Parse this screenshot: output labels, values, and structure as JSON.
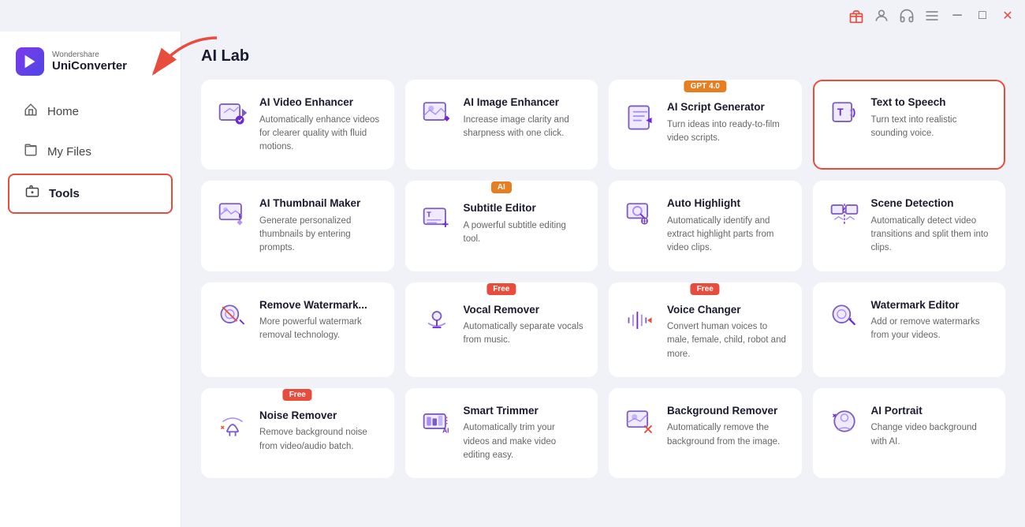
{
  "titleBar": {
    "icons": [
      "gift-icon",
      "user-icon",
      "headphone-icon",
      "menu-icon",
      "minimize-icon",
      "maximize-icon",
      "close-icon"
    ]
  },
  "sidebar": {
    "brand": {
      "top": "Wondershare",
      "name": "UniConverter"
    },
    "navItems": [
      {
        "id": "home",
        "label": "Home",
        "icon": "home"
      },
      {
        "id": "myfiles",
        "label": "My Files",
        "icon": "folder"
      },
      {
        "id": "tools",
        "label": "Tools",
        "icon": "tools",
        "active": true
      }
    ]
  },
  "main": {
    "pageTitle": "AI Lab",
    "tools": [
      {
        "id": "ai-video-enhancer",
        "name": "AI Video Enhancer",
        "desc": "Automatically enhance videos for clearer quality with fluid motions.",
        "badge": null,
        "highlighted": false
      },
      {
        "id": "ai-image-enhancer",
        "name": "AI Image Enhancer",
        "desc": "Increase image clarity and sharpness with one click.",
        "badge": null,
        "highlighted": false
      },
      {
        "id": "ai-script-generator",
        "name": "AI Script Generator",
        "desc": "Turn ideas into ready-to-film video scripts.",
        "badge": "GPT 4.0",
        "badgeType": "gpt",
        "highlighted": false
      },
      {
        "id": "text-to-speech",
        "name": "Text to Speech",
        "desc": "Turn text into realistic sounding voice.",
        "badge": null,
        "highlighted": true
      },
      {
        "id": "ai-thumbnail-maker",
        "name": "AI Thumbnail Maker",
        "desc": "Generate personalized thumbnails by entering prompts.",
        "badge": null,
        "highlighted": false
      },
      {
        "id": "subtitle-editor",
        "name": "Subtitle Editor",
        "desc": "A powerful subtitle editing tool.",
        "badge": "AI",
        "badgeType": "ai",
        "highlighted": false
      },
      {
        "id": "auto-highlight",
        "name": "Auto Highlight",
        "desc": "Automatically identify and extract highlight parts from video clips.",
        "badge": null,
        "highlighted": false
      },
      {
        "id": "scene-detection",
        "name": "Scene Detection",
        "desc": "Automatically detect video transitions and split them into clips.",
        "badge": null,
        "highlighted": false
      },
      {
        "id": "remove-watermark",
        "name": "Remove Watermark...",
        "desc": "More powerful watermark removal technology.",
        "badge": null,
        "highlighted": false
      },
      {
        "id": "vocal-remover",
        "name": "Vocal Remover",
        "desc": "Automatically separate vocals from music.",
        "badge": "Free",
        "badgeType": "free",
        "highlighted": false
      },
      {
        "id": "voice-changer",
        "name": "Voice Changer",
        "desc": "Convert human voices to male, female, child, robot and more.",
        "badge": "Free",
        "badgeType": "free",
        "highlighted": false
      },
      {
        "id": "watermark-editor",
        "name": "Watermark Editor",
        "desc": "Add or remove watermarks from your videos.",
        "badge": null,
        "highlighted": false
      },
      {
        "id": "noise-remover",
        "name": "Noise Remover",
        "desc": "Remove background noise from video/audio batch.",
        "badge": "Free",
        "badgeType": "free",
        "highlighted": false
      },
      {
        "id": "smart-trimmer",
        "name": "Smart Trimmer",
        "desc": "Automatically trim your videos and make video editing easy.",
        "badge": null,
        "highlighted": false
      },
      {
        "id": "background-remover",
        "name": "Background Remover",
        "desc": "Automatically remove the background from the image.",
        "badge": null,
        "highlighted": false
      },
      {
        "id": "ai-portrait",
        "name": "AI Portrait",
        "desc": "Change video background with AI.",
        "badge": null,
        "highlighted": false
      }
    ]
  }
}
